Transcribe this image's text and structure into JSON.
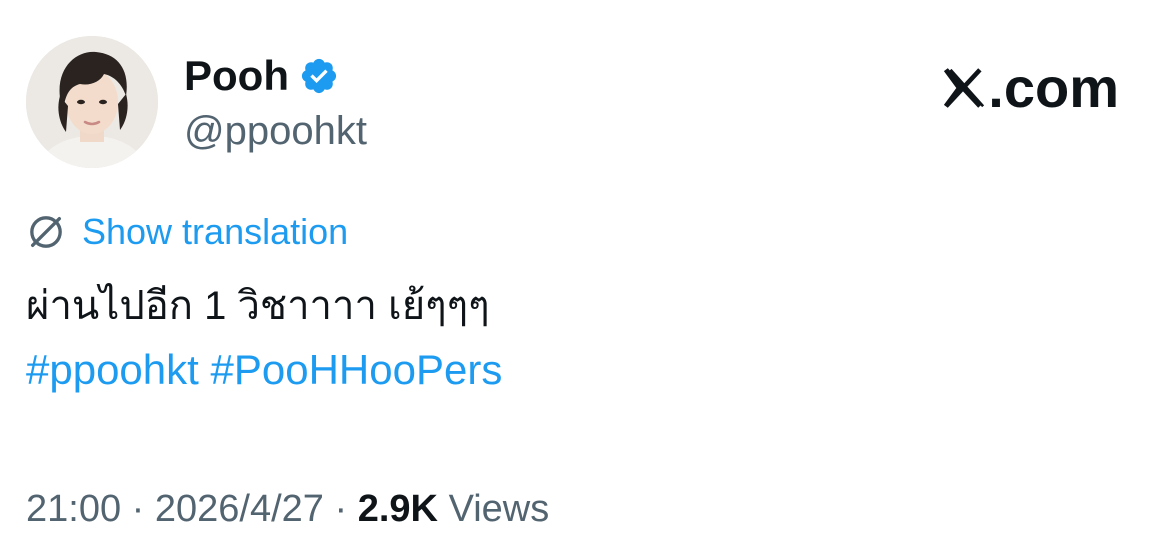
{
  "user": {
    "name": "Pooh",
    "handle": "@ppoohkt",
    "verified_color": "#1d9bf0"
  },
  "brand": {
    "domain": ".com"
  },
  "translation": {
    "label": "Show translation",
    "icon": "translate-icon"
  },
  "tweet": {
    "text": "ผ่านไปอีก 1 วิชาาาา เย้ๆๆๆ",
    "hashtags": [
      "#ppoohkt",
      "#PooHHooPers"
    ]
  },
  "meta": {
    "time": "21:00",
    "separator": "·",
    "date": "2026/4/27",
    "views_count": "2.9K",
    "views_label": "Views"
  },
  "colors": {
    "accent": "#1d9bf0",
    "text": "#0f1419",
    "secondary": "#536471"
  }
}
